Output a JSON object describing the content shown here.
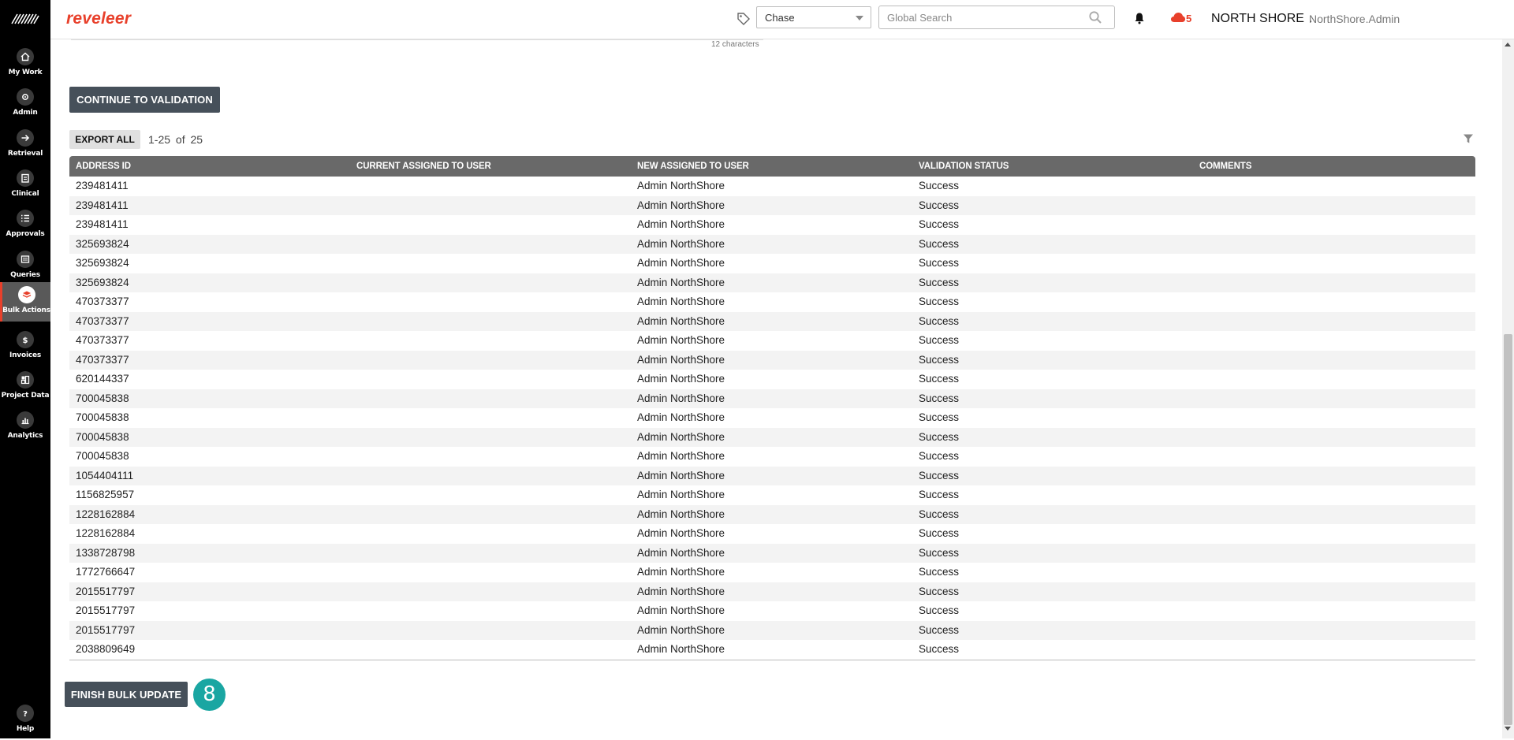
{
  "sidebar": {
    "items": [
      {
        "label": "My Work",
        "icon": "home-icon"
      },
      {
        "label": "Admin",
        "icon": "gear-icon"
      },
      {
        "label": "Retrieval",
        "icon": "arrow-right-icon"
      },
      {
        "label": "Clinical",
        "icon": "clipboard-icon"
      },
      {
        "label": "Approvals",
        "icon": "list-check-icon"
      },
      {
        "label": "Queries",
        "icon": "document-icon"
      },
      {
        "label": "Bulk Actions",
        "icon": "layers-icon",
        "active": true
      },
      {
        "label": "Invoices",
        "icon": "dollar-icon"
      },
      {
        "label": "Project Data",
        "icon": "grid-icon"
      },
      {
        "label": "Analytics",
        "icon": "chart-icon"
      }
    ],
    "help": {
      "label": "Help",
      "icon": "question-icon"
    }
  },
  "header": {
    "brand": "reveleer",
    "tag_select_value": "Chase",
    "search_placeholder": "Global Search",
    "notification_count": "5",
    "org": "NORTH SHORE",
    "org_separator": ":",
    "user": "NorthShore.Admin"
  },
  "form": {
    "char_count": "12 characters"
  },
  "actions": {
    "continue_label": "CONTINUE TO VALIDATION",
    "export_label": "EXPORT ALL",
    "pager": "1-25  of  25",
    "finish_label": "FINISH BULK UPDATE",
    "step_badge": "8"
  },
  "table": {
    "columns": [
      "ADDRESS ID",
      "CURRENT ASSIGNED TO USER",
      "NEW ASSIGNED TO USER",
      "VALIDATION STATUS",
      "COMMENTS"
    ],
    "rows": [
      [
        "239481411",
        "",
        "Admin NorthShore",
        "Success",
        ""
      ],
      [
        "239481411",
        "",
        "Admin NorthShore",
        "Success",
        ""
      ],
      [
        "239481411",
        "",
        "Admin NorthShore",
        "Success",
        ""
      ],
      [
        "325693824",
        "",
        "Admin NorthShore",
        "Success",
        ""
      ],
      [
        "325693824",
        "",
        "Admin NorthShore",
        "Success",
        ""
      ],
      [
        "325693824",
        "",
        "Admin NorthShore",
        "Success",
        ""
      ],
      [
        "470373377",
        "",
        "Admin NorthShore",
        "Success",
        ""
      ],
      [
        "470373377",
        "",
        "Admin NorthShore",
        "Success",
        ""
      ],
      [
        "470373377",
        "",
        "Admin NorthShore",
        "Success",
        ""
      ],
      [
        "470373377",
        "",
        "Admin NorthShore",
        "Success",
        ""
      ],
      [
        "620144337",
        "",
        "Admin NorthShore",
        "Success",
        ""
      ],
      [
        "700045838",
        "",
        "Admin NorthShore",
        "Success",
        ""
      ],
      [
        "700045838",
        "",
        "Admin NorthShore",
        "Success",
        ""
      ],
      [
        "700045838",
        "",
        "Admin NorthShore",
        "Success",
        ""
      ],
      [
        "700045838",
        "",
        "Admin NorthShore",
        "Success",
        ""
      ],
      [
        "1054404111",
        "",
        "Admin NorthShore",
        "Success",
        ""
      ],
      [
        "1156825957",
        "",
        "Admin NorthShore",
        "Success",
        ""
      ],
      [
        "1228162884",
        "",
        "Admin NorthShore",
        "Success",
        ""
      ],
      [
        "1228162884",
        "",
        "Admin NorthShore",
        "Success",
        ""
      ],
      [
        "1338728798",
        "",
        "Admin NorthShore",
        "Success",
        ""
      ],
      [
        "1772766647",
        "",
        "Admin NorthShore",
        "Success",
        ""
      ],
      [
        "2015517797",
        "",
        "Admin NorthShore",
        "Success",
        ""
      ],
      [
        "2015517797",
        "",
        "Admin NorthShore",
        "Success",
        ""
      ],
      [
        "2015517797",
        "",
        "Admin NorthShore",
        "Success",
        ""
      ],
      [
        "2038809649",
        "",
        "Admin NorthShore",
        "Success",
        ""
      ]
    ]
  },
  "colors": {
    "brand": "#e8402b",
    "sidebar_bg": "#000000",
    "table_header": "#696969",
    "button_dark": "#46505a",
    "step_badge": "#1aa6a2"
  }
}
